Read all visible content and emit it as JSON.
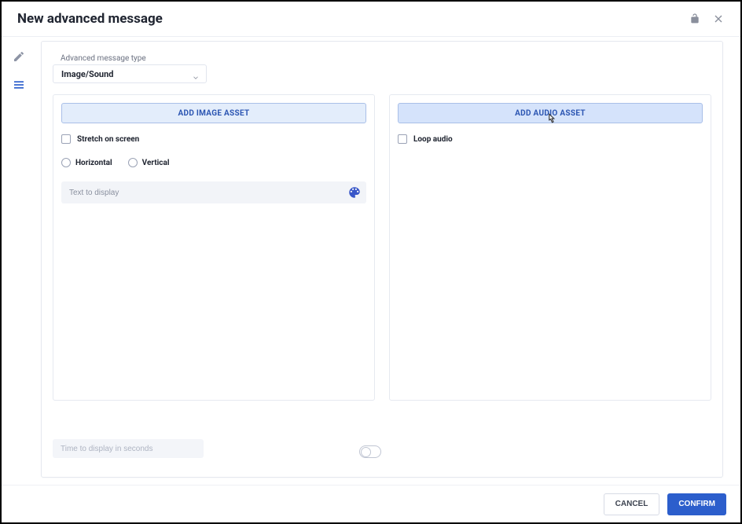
{
  "dialog": {
    "title": "New advanced message"
  },
  "typeSelector": {
    "label": "Advanced message type",
    "value": "Image/Sound"
  },
  "imagePanel": {
    "addButton": "ADD IMAGE ASSET",
    "stretchLabel": "Stretch on screen",
    "horizontalLabel": "Horizontal",
    "verticalLabel": "Vertical",
    "textPlaceholder": "Text to display"
  },
  "audioPanel": {
    "addButton": "ADD AUDIO ASSET",
    "loopLabel": "Loop audio"
  },
  "timeField": {
    "placeholder": "Time to display in seconds"
  },
  "footer": {
    "cancel": "CANCEL",
    "confirm": "CONFIRM"
  }
}
